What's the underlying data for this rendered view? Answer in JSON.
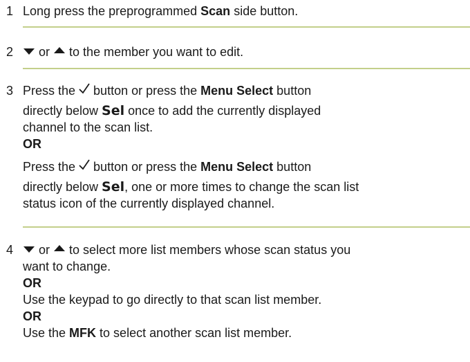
{
  "steps": [
    {
      "number": "1",
      "parts": {
        "a": "Long press the preprogrammed ",
        "b": "Scan",
        "c": " side button."
      }
    },
    {
      "number": "2",
      "parts": {
        "or": "or",
        "text": " to the member you want to edit."
      }
    },
    {
      "number": "3",
      "parts": {
        "p1a": "Press the ",
        "p1b": " button or press the ",
        "p1c": "Menu Select",
        "p1d": " button",
        "p2a": "directly below ",
        "p2b": "Sel",
        "p2c": " once to add the currently displayed",
        "p3": "channel to the scan list.",
        "or": "OR",
        "p4a": "Press the ",
        "p4b": " button or press the ",
        "p4c": "Menu Select",
        "p4d": " button",
        "p5a": "directly below ",
        "p5b": "Sel",
        "p5c": ", one or more times to change the scan list",
        "p6": "status icon of the currently displayed channel."
      }
    },
    {
      "number": "4",
      "parts": {
        "or_word": "or",
        "p1": " to select more list members whose scan status you",
        "p2": "want to change.",
        "or1": "OR",
        "p3": "Use the keypad to go directly to that scan list member.",
        "or2": "OR",
        "p4a": "Use the ",
        "p4b": "MFK",
        "p4c": " to select another scan list member."
      }
    }
  ],
  "icons": {
    "down": "down-arrow-icon",
    "up": "up-arrow-icon",
    "check": "checkmark-icon"
  },
  "colors": {
    "rule": "#c3cf8a",
    "text": "#1a1a1a"
  }
}
